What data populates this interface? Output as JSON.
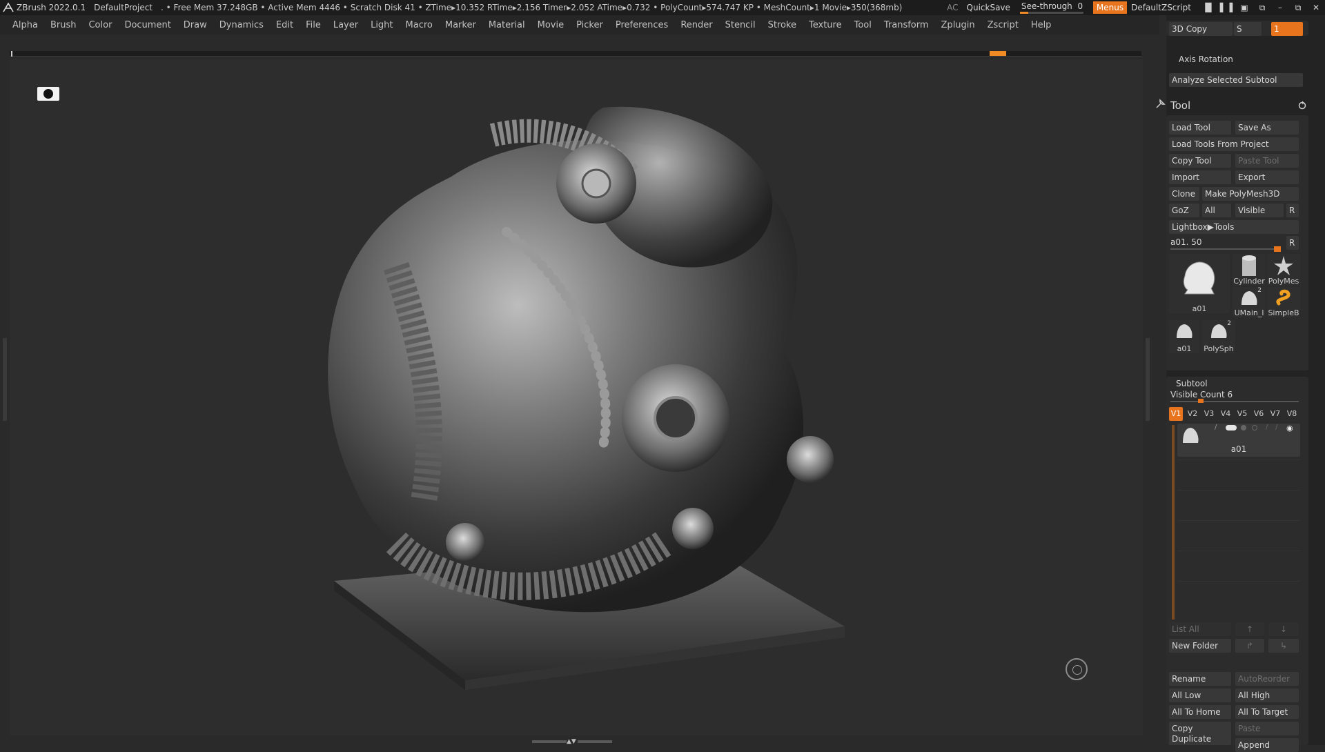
{
  "titlebar": {
    "app": "ZBrush 2022.0.1",
    "project": "DefaultProject",
    "status": ". • Free Mem 37.248GB • Active Mem 4446 • Scratch Disk 41 •  ZTime▸10.352 RTime▸2.156 Timer▸2.052 ATime▸0.732 • PolyCount▸574.747 KP  • MeshCount▸1  Movie▸350(368mb)",
    "ac": "AC",
    "quicksave": "QuickSave",
    "see_through_label": "See-through",
    "see_through_value": "0",
    "see_through_level": 0,
    "menus": "Menus",
    "script": "DefaultZScript"
  },
  "menubar": [
    "Alpha",
    "Brush",
    "Color",
    "Document",
    "Draw",
    "Dynamics",
    "Edit",
    "File",
    "Layer",
    "Light",
    "Macro",
    "Marker",
    "Material",
    "Movie",
    "Picker",
    "Preferences",
    "Render",
    "Stencil",
    "Stroke",
    "Texture",
    "Tool",
    "Transform",
    "Zplugin",
    "Zscript",
    "Help"
  ],
  "panel": {
    "copy3d": "3D Copy",
    "s_label": "S",
    "s_value": "1",
    "axis_rotation": "Axis Rotation",
    "analyze": "Analyze Selected Subtool",
    "tool_title": "Tool",
    "load_tool": "Load Tool",
    "save_as": "Save As",
    "load_from_project": "Load Tools From Project",
    "copy_tool": "Copy Tool",
    "paste_tool": "Paste Tool",
    "import": "Import",
    "export": "Export",
    "clone": "Clone",
    "make_polymesh": "Make PolyMesh3D",
    "goz": "GoZ",
    "all": "All",
    "visible": "Visible",
    "r": "R",
    "lightbox": "Lightbox▶Tools",
    "current_tool": "a01. 50",
    "r2": "R",
    "thumbs": {
      "main": "a01",
      "cylinder": "Cylinder",
      "polymesh": "PolyMes",
      "umain": "UMain_l",
      "umain_count": "2",
      "simpleb": "SimpleB",
      "a01": "a01",
      "polysph": "PolySph",
      "polysph_count": "2"
    },
    "subtool_title": "Subtool",
    "visible_count": "Visible Count 6",
    "vtabs": [
      "V1",
      "V2",
      "V3",
      "V4",
      "V5",
      "V6",
      "V7",
      "V8"
    ],
    "subtool_item": "a01",
    "list_all": "List All",
    "new_folder": "New Folder",
    "rename": "Rename",
    "autoreorder": "AutoReorder",
    "all_low": "All Low",
    "all_high": "All High",
    "all_to_home": "All To Home",
    "all_to_target": "All To Target",
    "copy": "Copy",
    "paste": "Paste",
    "duplicate": "Duplicate",
    "append": "Append"
  },
  "colors": {
    "accent": "#e8741d",
    "background": "#2d2d2d",
    "panel": "#232323"
  }
}
